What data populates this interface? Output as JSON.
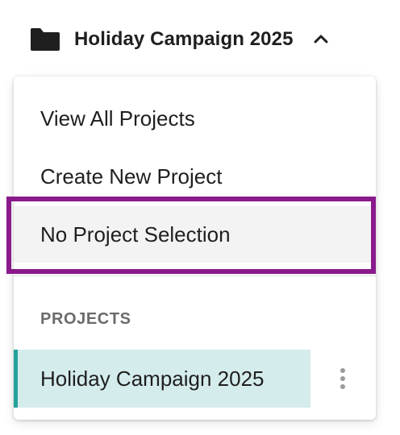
{
  "selector": {
    "title": "Holiday Campaign 2025",
    "icon": "folder-icon",
    "toggle_icon": "chevron-up-icon"
  },
  "menu": {
    "items": [
      {
        "label": "View All Projects"
      },
      {
        "label": "Create New Project"
      },
      {
        "label": "No Project Selection"
      }
    ]
  },
  "projects": {
    "header": "PROJECTS",
    "items": [
      {
        "label": "Holiday Campaign 2025",
        "selected": true,
        "menu_icon": "more-vertical-icon"
      }
    ]
  },
  "colors": {
    "highlight": "#8a1a8c",
    "selected_bg": "#d5ecec",
    "selected_accent": "#23a29a"
  }
}
